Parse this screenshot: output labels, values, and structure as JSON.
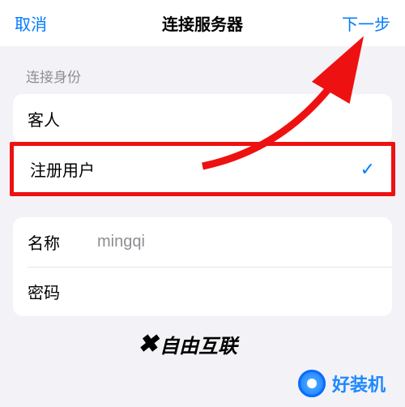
{
  "header": {
    "cancel": "取消",
    "title": "连接服务器",
    "next": "下一步"
  },
  "identity": {
    "sectionLabel": "连接身份",
    "guest": "客人",
    "registered": "注册用户",
    "checkmark": "✓"
  },
  "credentials": {
    "nameLabel": "名称",
    "nameValue": "mingqi",
    "passwordLabel": "密码"
  },
  "watermark1": "自由互联",
  "watermark2": "好装机"
}
